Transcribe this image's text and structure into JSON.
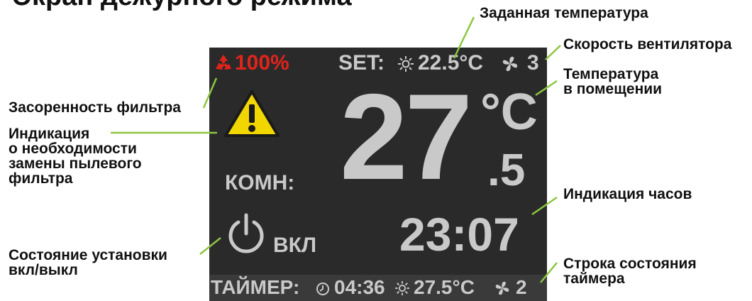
{
  "title": "Экран дежурного режима",
  "screen": {
    "filter_percent": "100%",
    "set_label": "SET:",
    "set_temp": "22.5°C",
    "fan_speed": "3",
    "big_temp": "27",
    "big_unit": "°C",
    "big_decimal": ".5",
    "room_label": "КОМН:",
    "power_label": "ВКЛ",
    "clock": "23:07",
    "timer_label": "ТАЙМЕР:",
    "timer_time": "04:36",
    "timer_temp": "27.5°C",
    "timer_fan": "2"
  },
  "labels": {
    "set_temp": [
      "Заданная температура"
    ],
    "fan_speed": [
      "Скорость вентилятора"
    ],
    "room_temp": [
      "Температура",
      "в помещении"
    ],
    "filter": [
      "Засоренность фильтра"
    ],
    "filter_warning": [
      "Индикация",
      "о необходимости",
      "замены пылевого",
      "фильтра"
    ],
    "clock": [
      "Индикация часов"
    ],
    "power": [
      "Состояние установки",
      "вкл/выкл"
    ],
    "timer": [
      "Строка состояния",
      "таймера"
    ]
  },
  "colors": {
    "screen_bg": "#2a2a2a",
    "screen_text": "#c9c9c9",
    "filter_red": "#e0241b",
    "warning_yellow": "#f2d600",
    "leader_green": "#8cc63f"
  },
  "icons": [
    "recycle-icon",
    "sun-icon",
    "fan-icon",
    "warning-icon",
    "power-icon",
    "clock-icon"
  ]
}
